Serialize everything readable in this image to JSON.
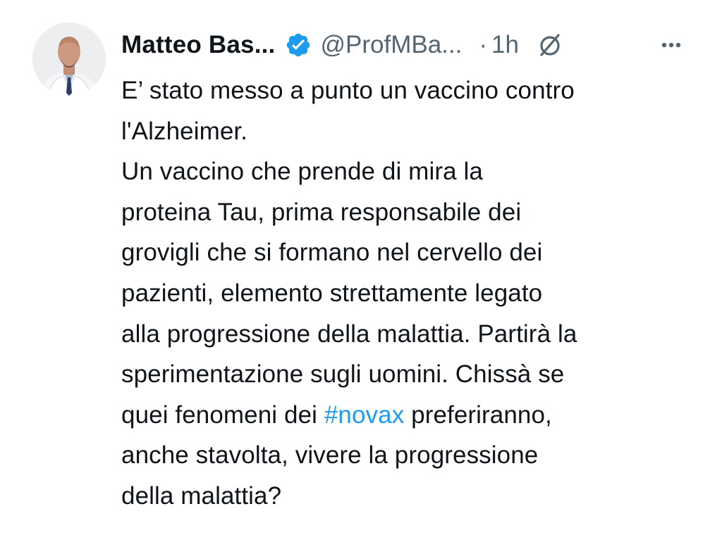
{
  "tweet": {
    "author": {
      "display_name": "Matteo Bas...",
      "handle": "@ProfMBa...",
      "verified": true,
      "avatar_icon": "profile-photo"
    },
    "time_separator": "·",
    "time": "1h",
    "icons": {
      "verified": "verified-badge-icon",
      "grok": "grok-icon",
      "more": "more-options-icon"
    },
    "colors": {
      "text": "#0f1419",
      "secondary": "#536471",
      "link": "#1d9bf0"
    },
    "text_lines": [
      "E’ stato messo a punto un vaccino contro",
      "l'Alzheimer.",
      "Un vaccino  che prende di mira la",
      "proteina Tau, prima responsabile dei",
      "grovigli che si formano nel cervello dei",
      "pazienti, elemento strettamente legato",
      "alla progressione della malattia. Partirà la",
      "sperimentazione sugli uomini. Chissà se"
    ],
    "hashtag_line": {
      "before": "quei fenomeni dei ",
      "hashtag": "#novax",
      "after": " preferiranno,"
    },
    "text_lines_end": [
      "anche stavolta, vivere la progressione",
      "della malattia?"
    ]
  }
}
